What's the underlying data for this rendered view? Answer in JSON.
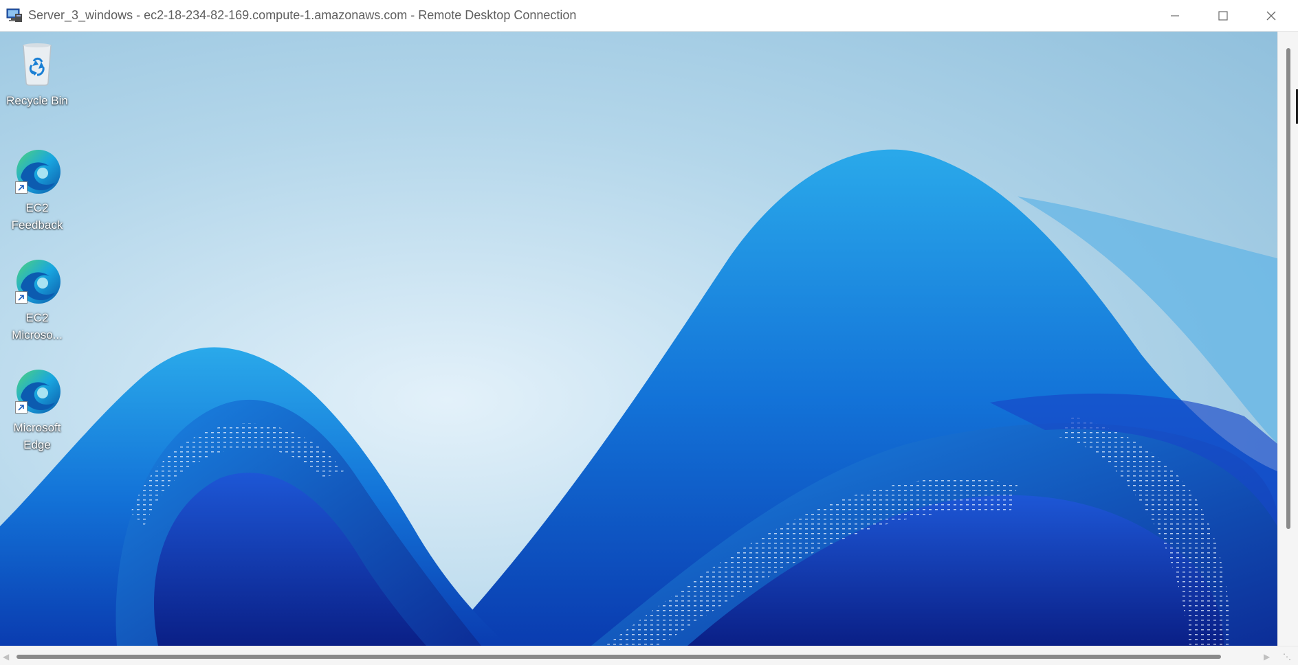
{
  "window": {
    "title": "Server_3_windows - ec2-18-234-82-169.compute-1.amazonaws.com - Remote Desktop Connection",
    "controls": {
      "minimize_icon": "minimize-icon",
      "maximize_icon": "maximize-icon",
      "close_icon": "close-icon"
    }
  },
  "desktop": {
    "icons": [
      {
        "label": "Recycle Bin",
        "icon": "recycle-bin-icon"
      },
      {
        "label": "EC2 Feedback",
        "icon": "edge-icon"
      },
      {
        "label": "EC2 Microso...",
        "icon": "edge-icon"
      },
      {
        "label": "Microsoft Edge",
        "icon": "edge-icon"
      }
    ]
  },
  "colors": {
    "accent": "#0a64c8",
    "wallpaper_light": "#dcecf6",
    "wallpaper_dark": "#0b2f9c"
  }
}
